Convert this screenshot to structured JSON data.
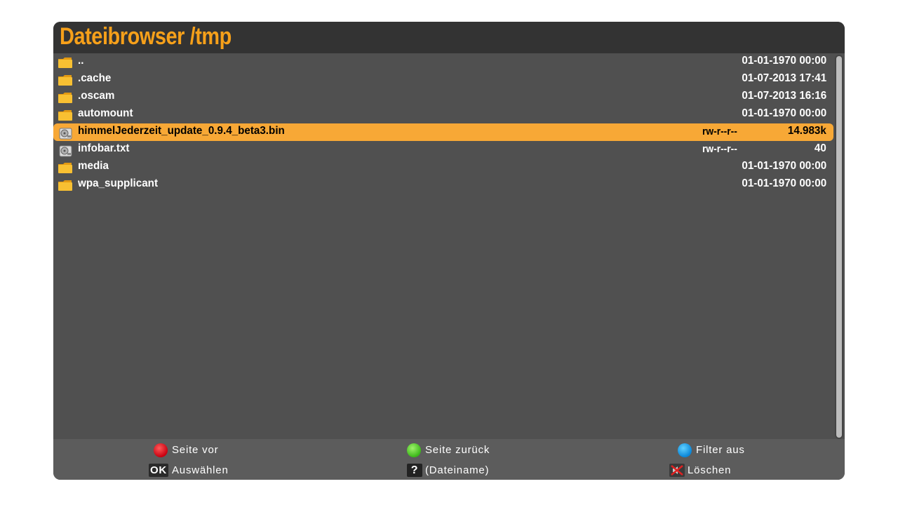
{
  "header": {
    "title": "Dateibrowser /tmp"
  },
  "files": [
    {
      "type": "folder",
      "icon": "folder-icon",
      "name": "..",
      "perm": "",
      "meta": "01-01-1970 00:00"
    },
    {
      "type": "folder",
      "icon": "folder-icon",
      "name": ".cache",
      "perm": "",
      "meta": "01-07-2013 17:41"
    },
    {
      "type": "folder",
      "icon": "folder-icon",
      "name": ".oscam",
      "perm": "",
      "meta": "01-07-2013 16:16"
    },
    {
      "type": "folder",
      "icon": "folder-icon",
      "name": "automount",
      "perm": "",
      "meta": "01-01-1970 00:00"
    },
    {
      "type": "file",
      "icon": "disk-file-icon",
      "name": "himmelJederzeit_update_0.9.4_beta3.bin",
      "perm": "rw-r--r--",
      "meta": "14.983k",
      "selected": true
    },
    {
      "type": "file",
      "icon": "disk-file-icon",
      "name": "infobar.txt",
      "perm": "rw-r--r--",
      "meta": "40"
    },
    {
      "type": "folder",
      "icon": "folder-icon",
      "name": "media",
      "perm": "",
      "meta": "01-01-1970 00:00"
    },
    {
      "type": "folder",
      "icon": "folder-icon",
      "name": "wpa_supplicant",
      "perm": "",
      "meta": "01-01-1970 00:00"
    }
  ],
  "footer": {
    "red": {
      "icon": "red-button-icon",
      "label": "Seite vor"
    },
    "green": {
      "icon": "green-button-icon",
      "label": "Seite zurück"
    },
    "blue": {
      "icon": "blue-button-icon",
      "label": "Filter aus"
    },
    "ok": {
      "icon": "ok-button-icon",
      "icon_text": "OK",
      "label": "Auswählen"
    },
    "help": {
      "icon": "help-button-icon",
      "icon_text": "?",
      "label": "(Dateiname)"
    },
    "mute": {
      "icon": "mute-button-icon",
      "label": "Löschen"
    }
  },
  "colors": {
    "accent": "#f6a01a",
    "selection": "#f7a836",
    "background": "#505050",
    "header": "#333333"
  }
}
